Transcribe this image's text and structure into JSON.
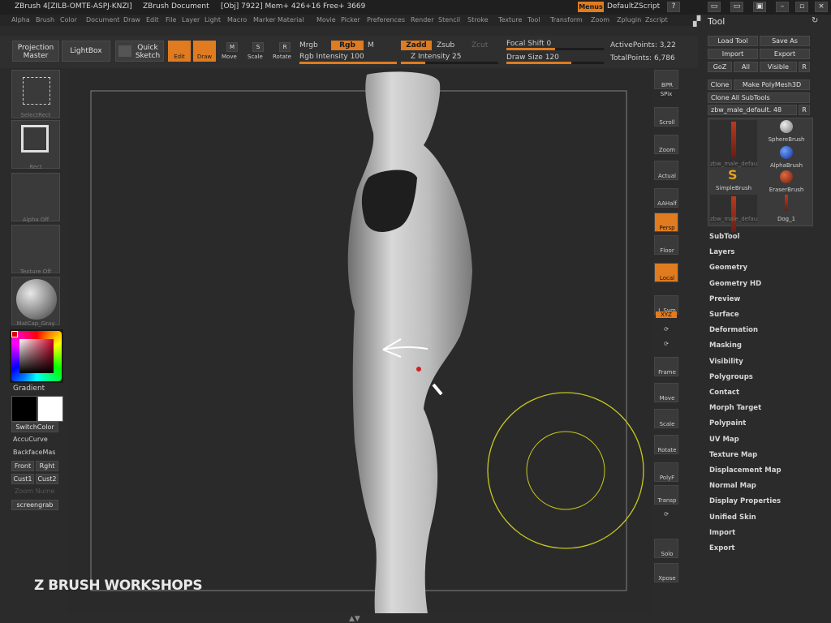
{
  "titlebar": {
    "app": "ZBrush 4[ZILB-OMTE-ASPJ-KNZI]",
    "doc": "ZBrush Document",
    "stats": "[Obj] 7922] Mem+ 426+16 Free+ 3669",
    "menus_btn": "Menus",
    "zscript": "DefaultZScript"
  },
  "menubar": [
    "Alpha",
    "Brush",
    "Color",
    "Document",
    "Draw",
    "Edit",
    "File",
    "Layer",
    "Light",
    "Macro",
    "Marker",
    "Material",
    "Movie",
    "Picker",
    "Preferences",
    "Render",
    "Stencil",
    "Stroke",
    "Texture",
    "Tool",
    "Transform",
    "Zoom",
    "Zplugin",
    "Zscript"
  ],
  "toolbar": {
    "projection_master": "Projection Master",
    "lightbox": "LightBox",
    "quick_sketch": "Quick Sketch",
    "edit": "Edit",
    "draw": "Draw",
    "move": "Move",
    "scale": "Scale",
    "rotate": "Rotate",
    "mrgb": "Mrgb",
    "rgb": "Rgb",
    "m": "M",
    "rgb_intensity": "Rgb Intensity 100",
    "zadd": "Zadd",
    "zsub": "Zsub",
    "zcut": "Zcut",
    "z_intensity": "Z Intensity 25",
    "focal_shift": "Focal Shift 0",
    "draw_size": "Draw Size 120",
    "active_points": "ActivePoints: 3,22",
    "total_points": "TotalPoints: 6,786",
    "rgb_intensity_value": 100,
    "z_intensity_value": 25,
    "focal_shift_value": 0,
    "draw_size_value": 120
  },
  "left": {
    "select_rect": "SelectRect",
    "rect": "Rect",
    "alpha_off": "Alpha Off",
    "texture_off": "Texture Off",
    "matcap": "MatCap_Gray",
    "gradient": "Gradient",
    "switchcolor": "SwitchColor",
    "accucurve": "AccuCurve",
    "backfacemask": "BackfaceMas",
    "front": "Front",
    "right": "Rght",
    "cust1": "Cust1",
    "cust2": "Cust2",
    "zoom_view": "Zoom Nume",
    "screengrab": "screengrab"
  },
  "rightstrip": [
    "BPR",
    "SPix",
    "Scroll",
    "Zoom",
    "Actual",
    "AAHalf",
    "Persp",
    "Floor",
    "Local",
    "L.Sym",
    "XYZ",
    "",
    "",
    "Frame",
    "Move",
    "Scale",
    "Rotate",
    "PolyF",
    "Transp",
    "",
    "Solo",
    "Xpose"
  ],
  "toolpanel": {
    "title": "Tool",
    "load_tool": "Load Tool",
    "save_as": "Save As",
    "import": "Import",
    "export": "Export",
    "goz": "GoZ",
    "all": "All",
    "visible": "Visible",
    "r": "R",
    "clone": "Clone",
    "make_polymesh": "Make PolyMesh3D",
    "clone_all": "Clone All SubTools",
    "current_tool": "zbw_male_default. 48",
    "brushes": [
      {
        "name": "zbw_male_defau",
        "icon": "figure-icon"
      },
      {
        "name": "SphereBrush",
        "icon": "sphere-icon"
      },
      {
        "name": "AlphaBrush",
        "icon": "alpha-sphere-icon"
      },
      {
        "name": "SimpleBrush",
        "icon": "simple-s-icon"
      },
      {
        "name": "EraserBrush",
        "icon": "eraser-sphere-icon"
      },
      {
        "name": "zbw_male_defau",
        "icon": "figure-icon"
      },
      {
        "name": "Dog_1",
        "icon": "dog-icon"
      }
    ],
    "sections": [
      "SubTool",
      "Layers",
      "Geometry",
      "Geometry HD",
      "Preview",
      "Surface",
      "Deformation",
      "Masking",
      "Visibility",
      "Polygroups",
      "Contact",
      "Morph Target",
      "Polypaint",
      "UV Map",
      "Texture Map",
      "Displacement Map",
      "Normal Map",
      "Display Properties",
      "Unified Skin",
      "Import",
      "Export"
    ]
  },
  "watermark": "Z BRUSH WORKSHOPS",
  "colors": {
    "accent": "#e07b1f",
    "brush_circle": "#c8c81e",
    "panel": "#2b2b2b"
  }
}
